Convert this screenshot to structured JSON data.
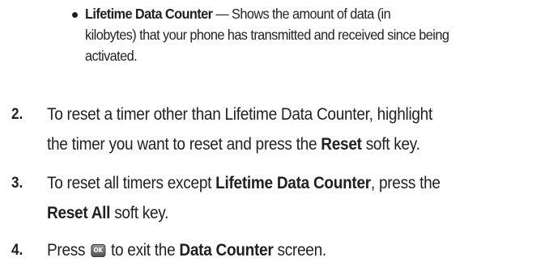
{
  "bullet": {
    "term": "Lifetime Data Counter",
    "description_line1": " — Shows the amount of data (in",
    "description_line2": "kilobytes) that your phone has transmitted and received since being",
    "description_line3": "activated."
  },
  "steps": [
    {
      "number": "2.",
      "line1": "To reset a timer other than Lifetime Data Counter, highlight",
      "line2_a": "the timer you want to reset and press the ",
      "line2_bold": "Reset",
      "line2_b": " soft key."
    },
    {
      "number": "3.",
      "line1_a": "To reset all timers except ",
      "line1_bold": "Lifetime Data Counter",
      "line1_b": ", press the",
      "line2_bold": "Reset All",
      "line2_b": " soft key."
    },
    {
      "number": "4.",
      "text_a": "Press ",
      "icon_label": "OK",
      "text_b": " to exit the ",
      "text_bold": "Data Counter",
      "text_c": " screen."
    }
  ]
}
